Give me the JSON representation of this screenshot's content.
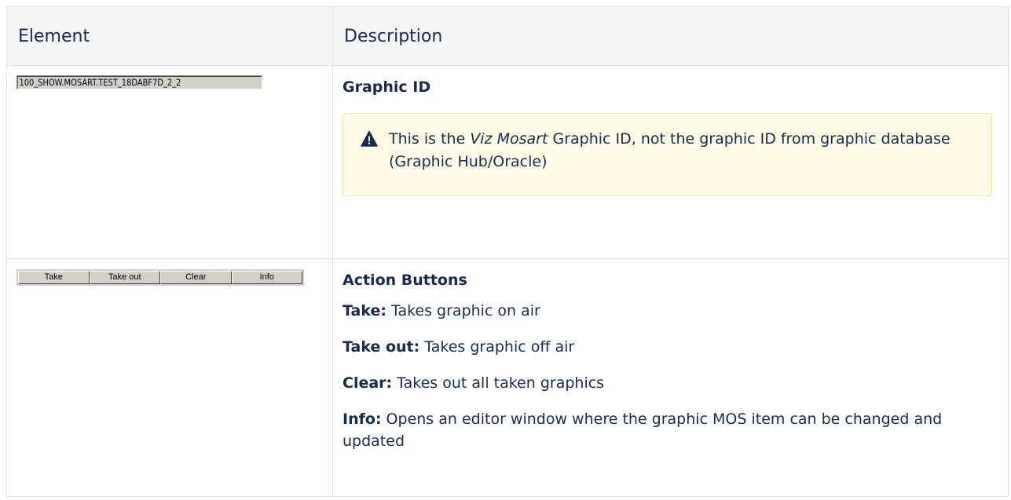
{
  "table": {
    "headers": [
      "Element",
      "Description"
    ]
  },
  "graphic_row": {
    "field_value": "100_SHOW.MOSART.TEST_18DABF7D_2_2",
    "heading": "Graphic ID",
    "warning": {
      "icon": "warning-icon",
      "text_before": "This is the ",
      "text_em": "Viz Mosart",
      "text_after": " Graphic ID, not the graphic ID from graphic database (Graphic Hub/Oracle)"
    }
  },
  "action_row": {
    "buttons": [
      "Take",
      "Take out",
      "Clear",
      "Info"
    ],
    "heading": "Action Buttons",
    "items": [
      {
        "term": "Take:",
        "text": " Takes graphic on air"
      },
      {
        "term": "Take out:",
        "text": " Takes graphic off air"
      },
      {
        "term": "Clear:",
        "text": " Takes out all taken graphics"
      },
      {
        "term": "Info:",
        "text": " Opens an editor window where the graphic MOS item can be changed and updated"
      }
    ]
  },
  "colors": {
    "header_bg": "#f4f5f7",
    "warning_bg": "#fffae6",
    "warning_icon": "#172b4d",
    "win_face": "#d4d0c8"
  }
}
